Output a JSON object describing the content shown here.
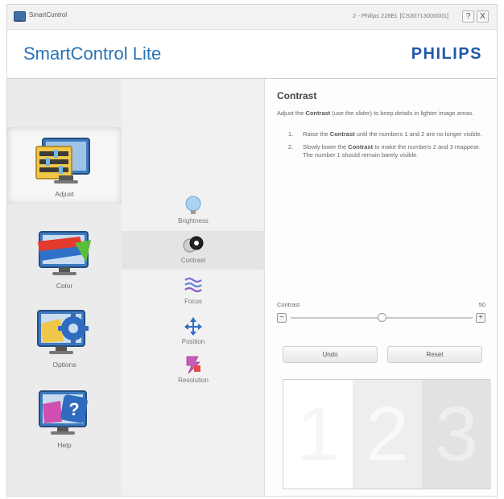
{
  "window": {
    "app_title": "SmartControl",
    "monitor_info": "2 - Philips 228EL [CS30713000001]",
    "help_label": "?",
    "close_label": "X"
  },
  "header": {
    "app_name": "SmartControl Lite",
    "brand": "PHILIPS"
  },
  "sidebar": {
    "items": [
      {
        "label": "Adjust",
        "icon": "adjust-icon",
        "selected": true
      },
      {
        "label": "Color",
        "icon": "color-icon",
        "selected": false
      },
      {
        "label": "Options",
        "icon": "options-icon",
        "selected": false
      },
      {
        "label": "Help",
        "icon": "help-icon",
        "selected": false
      }
    ]
  },
  "submenu": {
    "items": [
      {
        "label": "Brightness",
        "icon": "brightness-icon",
        "selected": false
      },
      {
        "label": "Contrast",
        "icon": "contrast-icon",
        "selected": true
      },
      {
        "label": "Focus",
        "icon": "focus-icon",
        "selected": false
      },
      {
        "label": "Position",
        "icon": "position-icon",
        "selected": false
      },
      {
        "label": "Resolution",
        "icon": "resolution-icon",
        "selected": false
      }
    ]
  },
  "panel": {
    "title": "Contrast",
    "desc_pre": "Adjust the ",
    "desc_bold": "Contrast",
    "desc_post": " (use the slider) to keep details in lighter image areas.",
    "steps": [
      {
        "num": "1.",
        "pre": "Raise the ",
        "bold": "Contrast",
        "post": " until the numbers 1 and 2 are no longer visible."
      },
      {
        "num": "2.",
        "pre": "Slowly lower the ",
        "bold": "Contrast",
        "post": " to make the numbers 2 and 3 reappear. The number 1 should remain barely visible."
      }
    ],
    "slider": {
      "label": "Contrast",
      "value": "50",
      "min": 0,
      "max": 100,
      "level": 50,
      "minus": "−",
      "plus": "+"
    },
    "undo_label": "Undo",
    "reset_label": "Reset",
    "preview_digits": [
      "1",
      "2",
      "3"
    ]
  },
  "colors": {
    "accent": "#2a73b5",
    "brand": "#1e5aa6"
  }
}
